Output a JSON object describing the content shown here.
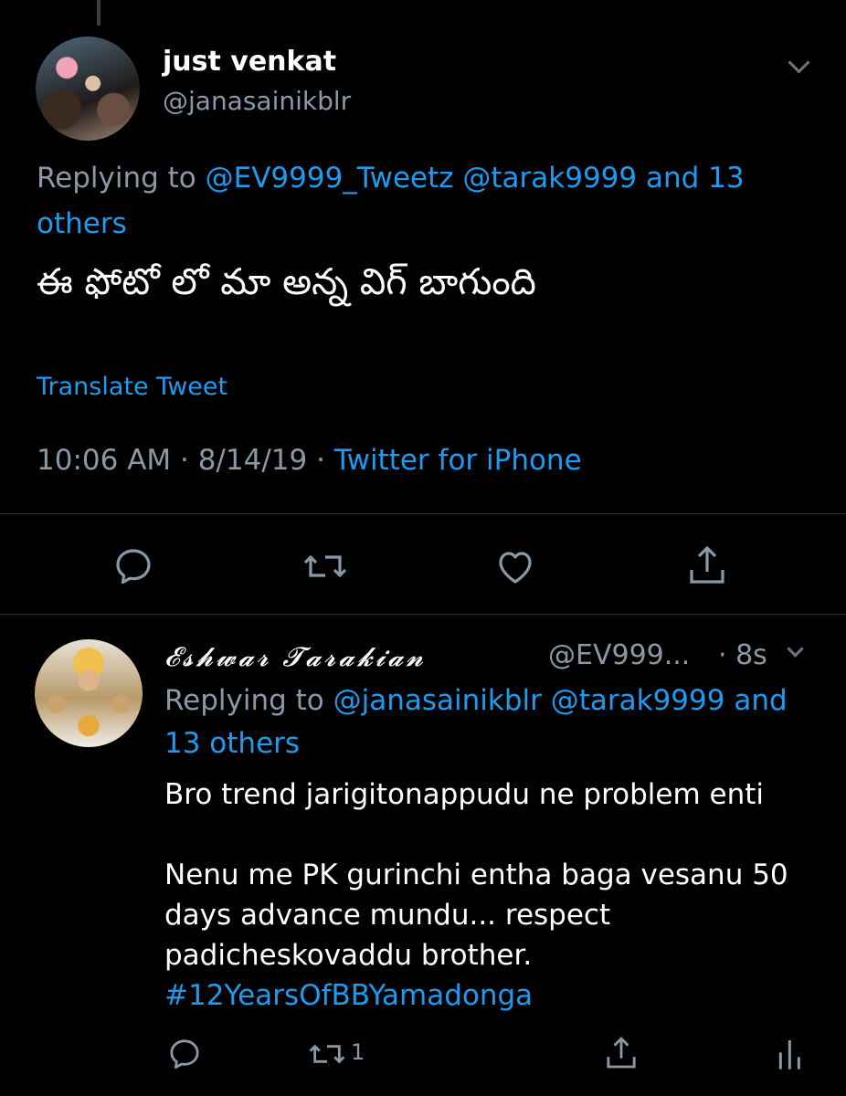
{
  "tweet1": {
    "name": "just venkat",
    "handle": "@janasainikblr",
    "replying_prefix": "Replying to ",
    "replying_mentions": "@EV9999_Tweetz @tarak9999 and 13 others",
    "text": "ఈ ఫోటో లో మా అన్న విగ్ బాగుంది",
    "translate": "Translate Tweet",
    "time": "10:06 AM · 8/14/19 · ",
    "source": "Twitter for iPhone",
    "actions": [
      "reply-icon",
      "retweet-icon",
      "like-icon",
      "share-icon"
    ]
  },
  "tweet2": {
    "name": "𝓔𝓼𝓱𝔀𝓪𝓻 𝓣𝓪𝓻𝓪𝓴𝓲𝓪𝓷",
    "handle": "@EV999...",
    "time": "· 8s",
    "replying_prefix": "Replying to ",
    "replying_mentions": "@janasainikblr @tarak9999 and 13 others",
    "text": "Bro trend jarigitonappudu ne problem enti\n\nNenu me PK gurinchi entha baga vesanu 50 days advance mundu... respect padicheskovaddu brother.",
    "hashtag": "#12YearsOfBBYamadonga",
    "retweet_count": "1",
    "actions": [
      "reply-icon",
      "retweet-icon",
      "share-icon",
      "analytics-icon"
    ]
  },
  "colors": {
    "background": "#000000",
    "link": "#1d9bf0",
    "muted": "#8b98a5",
    "divider": "#2f3336"
  }
}
